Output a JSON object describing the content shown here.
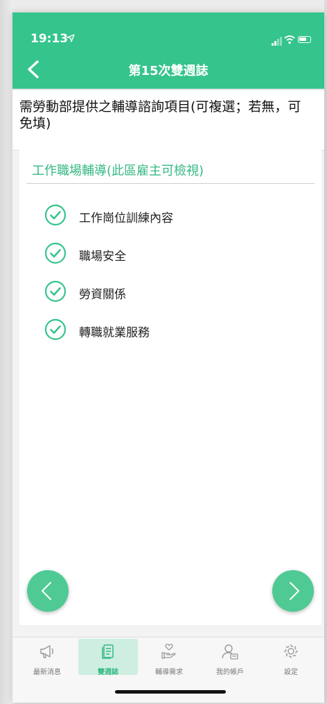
{
  "status_bar": {
    "time": "19:13"
  },
  "nav": {
    "title": "第15次雙週誌"
  },
  "question": {
    "text": "需勞動部提供之輔導諮詢項目(可複選；若無，可免填)"
  },
  "section": {
    "title": "工作職場輔導(此區雇主可檢視)",
    "options": [
      {
        "label": "工作崗位訓練內容",
        "checked": true
      },
      {
        "label": "職場安全",
        "checked": true
      },
      {
        "label": "勞資關係",
        "checked": true
      },
      {
        "label": "轉職就業服務",
        "checked": true
      }
    ]
  },
  "tabs": [
    {
      "label": "最新消息",
      "icon": "megaphone-icon",
      "active": false
    },
    {
      "label": "雙週誌",
      "icon": "notebook-icon",
      "active": true
    },
    {
      "label": "輔導需求",
      "icon": "hand-heart-icon",
      "active": false
    },
    {
      "label": "我的帳戶",
      "icon": "user-card-icon",
      "active": false
    },
    {
      "label": "設定",
      "icon": "gear-icon",
      "active": false
    }
  ],
  "colors": {
    "primary": "#35c48c",
    "fab": "#4fca95",
    "active_tab_bg": "#cdeee0",
    "accent_text": "#35b883"
  }
}
